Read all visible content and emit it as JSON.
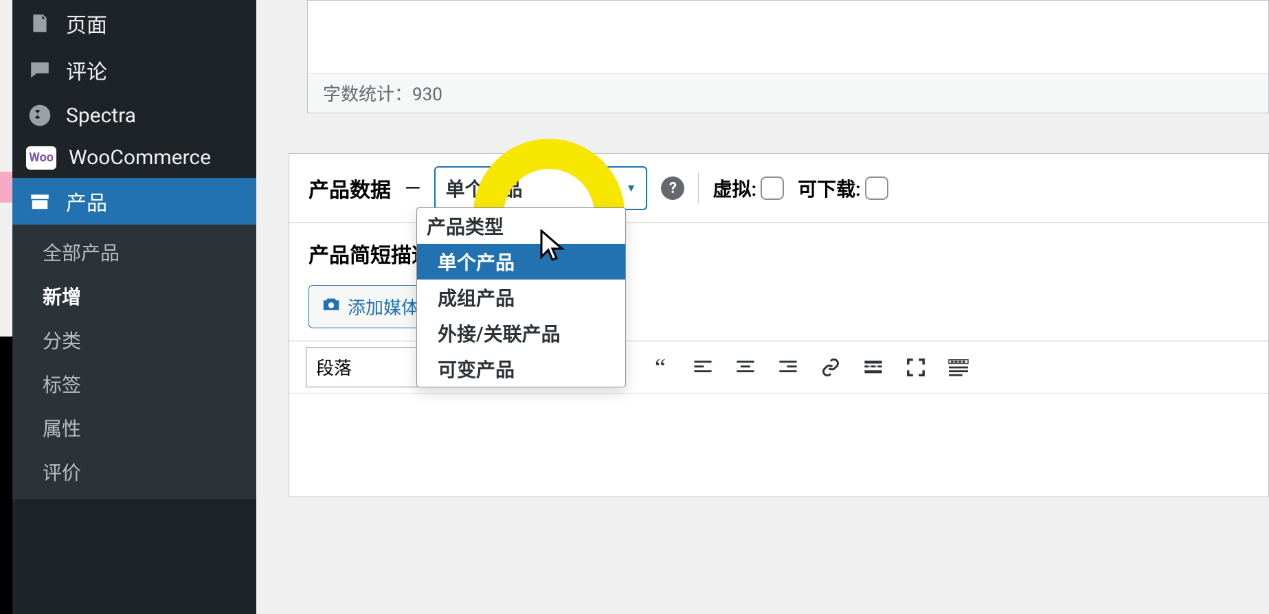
{
  "sidebar": {
    "pages": "页面",
    "comments": "评论",
    "spectra": "Spectra",
    "woocommerce": "WooCommerce",
    "products": "产品",
    "submenu": {
      "all": "全部产品",
      "add": "新增",
      "categories": "分类",
      "tags": "标签",
      "attributes": "属性",
      "reviews": "评价"
    }
  },
  "editor": {
    "word_count_label": "字数统计：",
    "word_count": "930"
  },
  "product_data": {
    "title": "产品数据",
    "dash": "—",
    "select_value": "单个产品",
    "help": "?",
    "virtual_label": "虚拟:",
    "downloadable_label": "可下载:",
    "dropdown": {
      "group": "产品类型",
      "options": [
        "单个产品",
        "成组产品",
        "外接/关联产品",
        "可变产品"
      ]
    }
  },
  "short_desc": {
    "title": "产品简短描述",
    "add_media": "添加媒体",
    "format": "段落"
  }
}
